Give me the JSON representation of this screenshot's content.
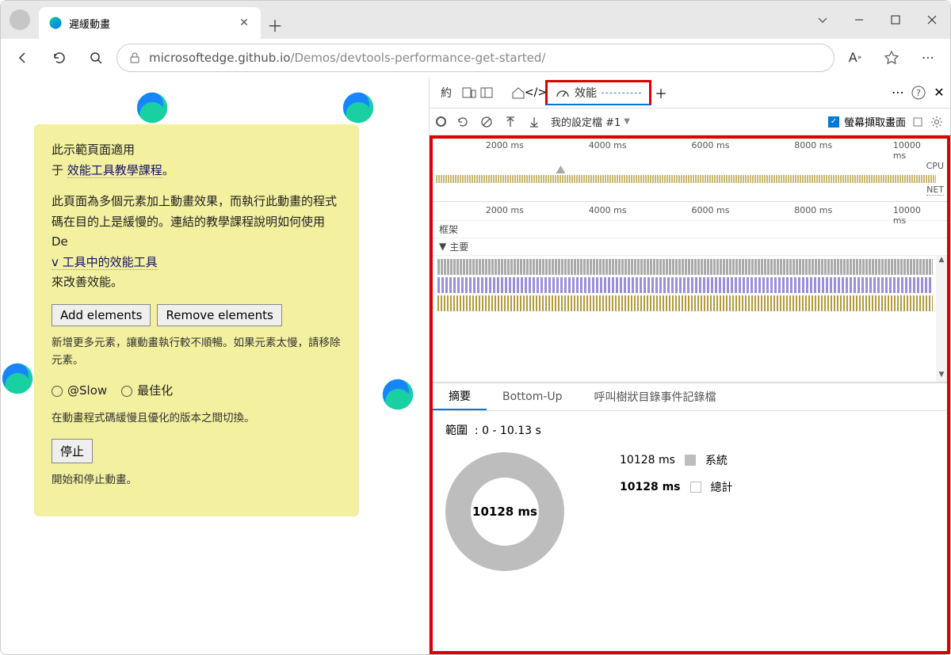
{
  "browser": {
    "tab_title": "遲緩動畫",
    "url_host": "microsoftedge.github.io",
    "url_path": "/Demos/devtools-performance-get-started/"
  },
  "page": {
    "intro_1": "此示範頁面適用",
    "intro_2": "于",
    "intro_link": "效能工具教學課程",
    "intro_3": "。",
    "p2_1": "此頁面為多個元素加上動畫效果，而執行此動畫的程式碼在目的上是緩慢的。連結的教學課程說明如何使用 De",
    "p2_link": "v 工具中的效能工具",
    "p2_2": "來改善效能。",
    "btn_add": "Add elements",
    "btn_remove": "Remove elements",
    "hint_buttons": "新增更多元素，讓動畫執行較不順暢。如果元素太慢，請移除元素。",
    "radio_slow": "@Slow",
    "radio_opt": "最佳化",
    "hint_radio": "在動畫程式碼緩慢且優化的版本之間切換。",
    "btn_stop": "停止",
    "hint_stop": "開始和停止動畫。"
  },
  "devtools": {
    "tab_about": "約",
    "tab_perf": "效能",
    "profile_label": "我的設定檔 #1",
    "screenshot_label": "螢幕擷取畫面",
    "timeline_ticks": [
      "2000 ms",
      "4000 ms",
      "6000 ms",
      "8000 ms",
      "10000 ms"
    ],
    "cpu_label": "CPU",
    "net_label": "NET",
    "frame_label": "框架",
    "main_label": "主要",
    "summary_tabs": {
      "summary": "摘要",
      "bottom_up": "Bottom-Up",
      "call_tree": "呼叫樹狀目錄事件記錄檔"
    },
    "range_label": "範圍",
    "range_value": ": 0 - 10.13 s",
    "donut_value": "10128 ms",
    "legend_system_ms": "10128 ms",
    "legend_system": "系統",
    "legend_total_ms": "10128 ms",
    "legend_total": "總計"
  }
}
